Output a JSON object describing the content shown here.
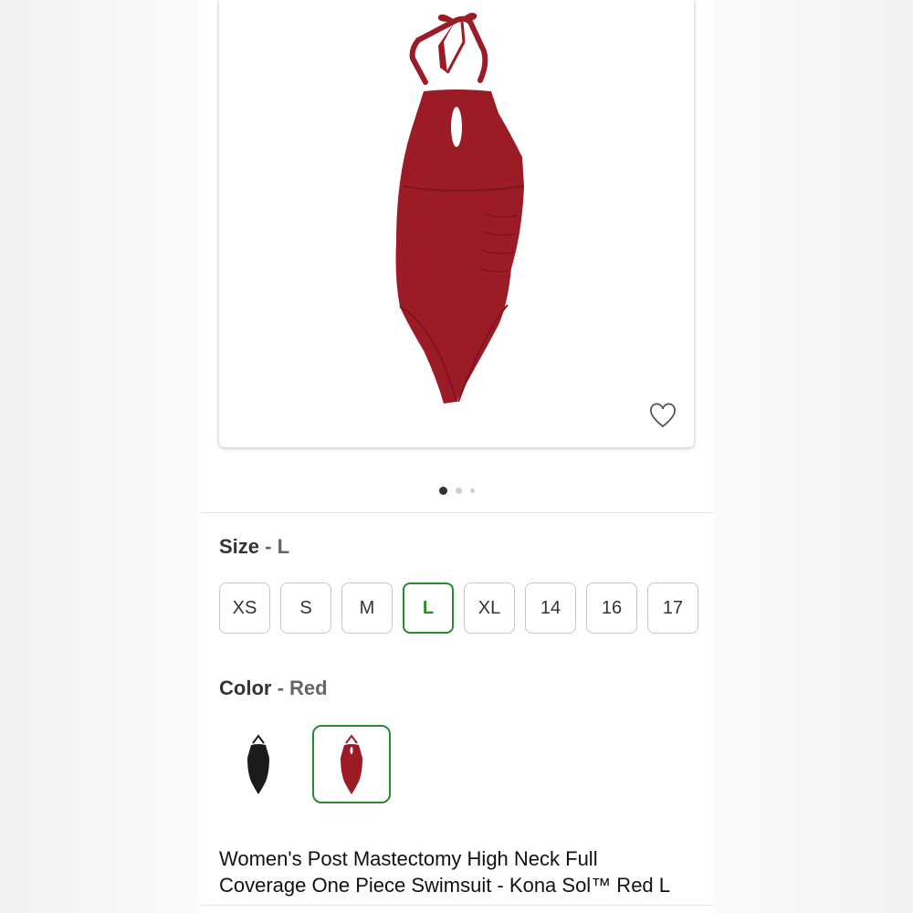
{
  "gallery": {
    "product_color": "#9b1c26",
    "favorite_icon": "heart-outline-icon",
    "dots_count": 3,
    "active_dot": 1
  },
  "size": {
    "label": "Size",
    "separator": " - ",
    "selected_value": "L",
    "options": [
      "XS",
      "S",
      "M",
      "L",
      "XL",
      "14",
      "16",
      "17"
    ],
    "accent_color": "#2a8a2e"
  },
  "color": {
    "label": "Color",
    "separator": " - ",
    "selected_value": "Red",
    "options": [
      {
        "name": "Black",
        "swatch_color": "#1b1b1b"
      },
      {
        "name": "Red",
        "swatch_color": "#9b1c26"
      }
    ]
  },
  "product": {
    "title_line1": "Women's Post Mastectomy High Neck Full",
    "title_line2": "Coverage One Piece Swimsuit - Kona Sol™ Red L"
  }
}
